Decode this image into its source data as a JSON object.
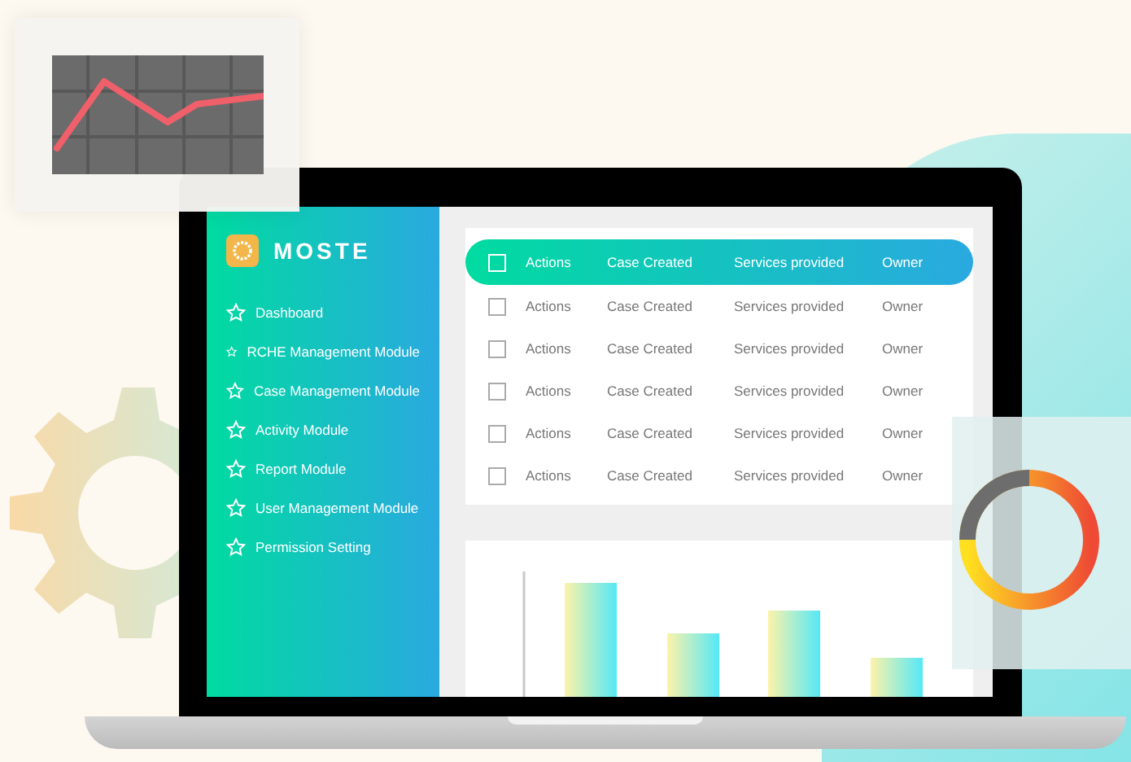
{
  "app": {
    "logo": "MOSTE"
  },
  "sidebar": {
    "items": [
      {
        "label": "Dashboard"
      },
      {
        "label": "RCHE Management Module"
      },
      {
        "label": "Case Management Module"
      },
      {
        "label": "Activity Module"
      },
      {
        "label": "Report Module"
      },
      {
        "label": "User Management Module"
      },
      {
        "label": "Permission Setting"
      }
    ]
  },
  "table": {
    "header": {
      "checked": false,
      "columns": [
        "Actions",
        "Case Created",
        "Services provided",
        "Owner"
      ]
    },
    "rows": [
      {
        "checked": false,
        "cells": [
          "Actions",
          "Case Created",
          "Services provided",
          "Owner"
        ]
      },
      {
        "checked": false,
        "cells": [
          "Actions",
          "Case Created",
          "Services provided",
          "Owner"
        ]
      },
      {
        "checked": false,
        "cells": [
          "Actions",
          "Case Created",
          "Services provided",
          "Owner"
        ]
      },
      {
        "checked": false,
        "cells": [
          "Actions",
          "Case Created",
          "Services provided",
          "Owner"
        ]
      },
      {
        "checked": false,
        "cells": [
          "Actions",
          "Case Created",
          "Services provided",
          "Owner"
        ]
      }
    ]
  }
}
